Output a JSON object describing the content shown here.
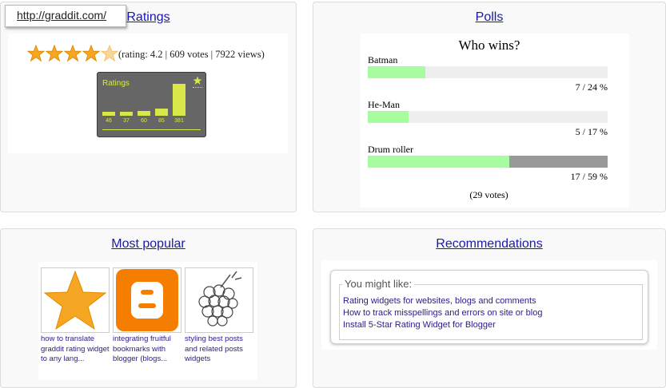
{
  "tooltip": {
    "url": "http://graddit.com/"
  },
  "ratings": {
    "title": "Ratings",
    "stars": {
      "filled": 4,
      "total": 5,
      "value": 4.2
    },
    "summary": "(rating: 4.2 | 609 votes | 7922 views)",
    "widget": {
      "title": "Ratings",
      "icon": "star-icon",
      "bars": [
        {
          "label": "46",
          "value": 46
        },
        {
          "label": "37",
          "value": 37
        },
        {
          "label": "60",
          "value": 60
        },
        {
          "label": "85",
          "value": 85
        },
        {
          "label": "381",
          "value": 381
        }
      ],
      "color": "#d8e84a",
      "background": "#666666"
    }
  },
  "polls": {
    "title": "Polls",
    "question": "Who wins?",
    "options": [
      {
        "label": "Batman",
        "result": "7 / 24 %",
        "percent": 24
      },
      {
        "label": "He-Man",
        "result": "5 / 17 %",
        "percent": 17
      },
      {
        "label": "Drum roller",
        "result": "17 / 59 %",
        "percent": 59
      }
    ],
    "total": "(29 votes)",
    "fill_color": "#a8fca0"
  },
  "most_popular": {
    "title": "Most popular",
    "items": [
      {
        "icon": "star-icon",
        "text": "how to translate graddit rating widget to any lang..."
      },
      {
        "icon": "blogger-icon",
        "text": "integrating fruitful bookmarks with blogger (blogs..."
      },
      {
        "icon": "raspberry-icon",
        "text": "styling best posts and related posts widgets"
      }
    ]
  },
  "recommendations": {
    "title": "Recommendations",
    "legend": "You might like:",
    "links": [
      "Rating widgets for websites, blogs and comments",
      "How to track misspellings and errors on site or blog",
      "Install 5-Star Rating Widget for Blogger"
    ]
  }
}
